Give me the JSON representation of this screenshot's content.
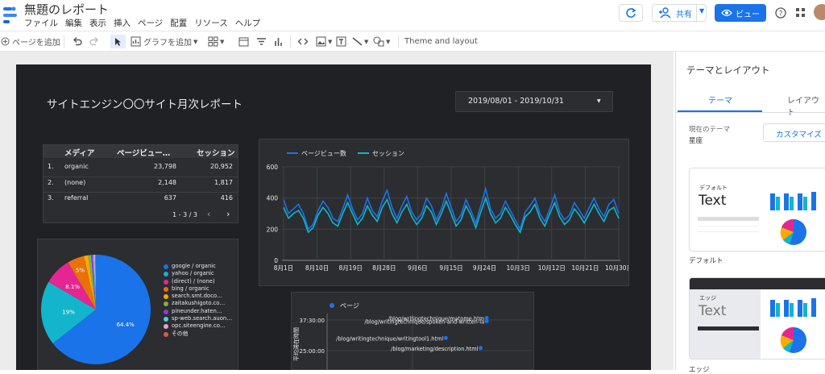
{
  "app": {
    "title": "無題のレポート",
    "menu": [
      "ファイル",
      "編集",
      "表示",
      "挿入",
      "ページ",
      "配置",
      "リソース",
      "ヘルプ"
    ],
    "share_label": "共有",
    "view_label": "ビュー"
  },
  "toolbar": {
    "add_page": "ページを追加",
    "add_chart": "グラフを追加",
    "theme_layout": "Theme and layout"
  },
  "report": {
    "title": "サイトエンジン〇〇サイト月次レポート",
    "date_range": "2019/08/01 - 2019/10/31"
  },
  "table": {
    "headers": [
      "メディア",
      "ページビュー…",
      "セッション"
    ],
    "rows": [
      {
        "num": "1.",
        "media": "organic",
        "pv": "23,798",
        "sessions": "20,952"
      },
      {
        "num": "2.",
        "media": "(none)",
        "pv": "2,148",
        "sessions": "1,817"
      },
      {
        "num": "3.",
        "media": "referral",
        "pv": "637",
        "sessions": "416"
      }
    ],
    "pagination": "1 - 3 / 3"
  },
  "pie": {
    "legend": [
      "google / organic",
      "yahoo / organic",
      "(direct) / (none)",
      "bing / organic",
      "search.smt.doco…",
      "zaitakushigoto.co…",
      "pineunder.haten…",
      "sp-web.search.auon…",
      "opc.siteengine.co…",
      "その他"
    ],
    "colors": [
      "#1a73e8",
      "#12b5cb",
      "#e52592",
      "#e8710a",
      "#f9ab00",
      "#7cb342",
      "#9334e6",
      "#4ecde6",
      "#e8a1d6",
      "#d05f4a"
    ],
    "values": [
      64.4,
      19,
      8.1,
      5,
      1.2,
      0.9,
      0.5,
      0.4,
      0.3,
      0.2
    ],
    "labels": [
      "64.4%",
      "19%",
      "8.1%",
      "5%"
    ]
  },
  "chart_data": [
    {
      "type": "line",
      "series": [
        {
          "name": "ページビュー数",
          "color": "#1a73e8",
          "values": [
            390,
            300,
            330,
            360,
            300,
            200,
            230,
            320,
            380,
            340,
            270,
            250,
            330,
            420,
            330,
            260,
            300,
            400,
            320,
            280,
            380,
            450,
            340,
            270,
            350,
            410,
            310,
            260,
            300,
            400,
            350,
            260,
            330,
            430,
            340,
            250,
            290,
            390,
            320,
            240,
            350,
            460,
            330,
            270,
            300,
            380,
            320,
            260,
            200,
            310,
            350,
            400,
            300,
            250,
            330,
            420,
            310,
            260,
            290,
            370,
            320,
            270,
            340,
            400,
            330,
            280,
            360,
            390,
            300
          ]
        },
        {
          "name": "セッション",
          "color": "#12b5cb",
          "values": [
            340,
            270,
            300,
            320,
            270,
            180,
            210,
            290,
            340,
            300,
            240,
            220,
            300,
            370,
            300,
            230,
            270,
            350,
            290,
            250,
            340,
            390,
            300,
            240,
            310,
            360,
            280,
            230,
            270,
            350,
            310,
            230,
            300,
            380,
            300,
            220,
            260,
            350,
            290,
            210,
            310,
            400,
            300,
            240,
            270,
            340,
            290,
            230,
            180,
            280,
            310,
            360,
            270,
            220,
            300,
            370,
            280,
            230,
            260,
            330,
            290,
            240,
            300,
            360,
            300,
            250,
            320,
            340,
            270
          ]
        }
      ],
      "xticks": [
        "8月1日",
        "8月10日",
        "8月19日",
        "8月28日",
        "9月6日",
        "9月15日",
        "9月24日",
        "10月3日",
        "10月12日",
        "10月21日",
        "10月30日"
      ],
      "yticks": [
        "0",
        "200",
        "400",
        "600"
      ],
      "ylim": [
        0,
        600
      ]
    },
    {
      "type": "scatter",
      "series": [
        {
          "name": "ページ"
        }
      ],
      "yticks": [
        "37:30:00",
        "25:00:00"
      ],
      "ylabel": "平均滞在時間",
      "points": [
        {
          "label": "/blog/writingtechnique/matome.htm",
          "x": 0.78,
          "y": 0.92
        },
        {
          "label": "/blog/writingtechnique/spoken-and-written-la",
          "x": 0.78,
          "y": 0.86
        },
        {
          "label": "/blog/writingtechnique/writingtool1.html",
          "x": 0.58,
          "y": 0.56
        },
        {
          "label": "/blog/marketing/description.html",
          "x": 0.75,
          "y": 0.38
        }
      ]
    }
  ],
  "sidebar": {
    "title": "テーマとレイアウト",
    "tabs": [
      "テーマ",
      "レイアウト"
    ],
    "current_theme_label": "現在のテーマ",
    "current_theme": "星座",
    "customize": "カスタマイズ",
    "theme_default_badge": "デフォルト",
    "theme_default_text": "Text",
    "theme_default_name": "デフォルト",
    "theme_edge_badge": "エッジ",
    "theme_edge_text": "Text",
    "theme_edge_name": "エッジ"
  }
}
